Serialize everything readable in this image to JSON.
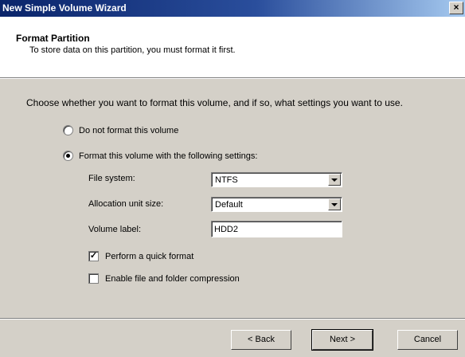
{
  "window": {
    "title": "New Simple Volume Wizard",
    "close_glyph": "×"
  },
  "header": {
    "title": "Format Partition",
    "subtitle": "To store data on this partition, you must format it first."
  },
  "intro": "Choose whether you want to format this volume, and if so, what settings you want to use.",
  "options": {
    "do_not_format": {
      "label": "Do not format this volume",
      "selected": false
    },
    "format_with": {
      "label": "Format this volume with the following settings:",
      "selected": true
    }
  },
  "settings": {
    "file_system": {
      "label": "File system:",
      "value": "NTFS"
    },
    "allocation": {
      "label": "Allocation unit size:",
      "value": "Default"
    },
    "volume_label": {
      "label": "Volume label:",
      "value": "HDD2"
    }
  },
  "checkboxes": {
    "quick_format": {
      "label": "Perform a quick format",
      "checked": true,
      "check_glyph": "✓"
    },
    "compression": {
      "label": "Enable file and folder compression",
      "checked": false
    }
  },
  "buttons": {
    "back": "< Back",
    "next": "Next >",
    "cancel": "Cancel"
  }
}
